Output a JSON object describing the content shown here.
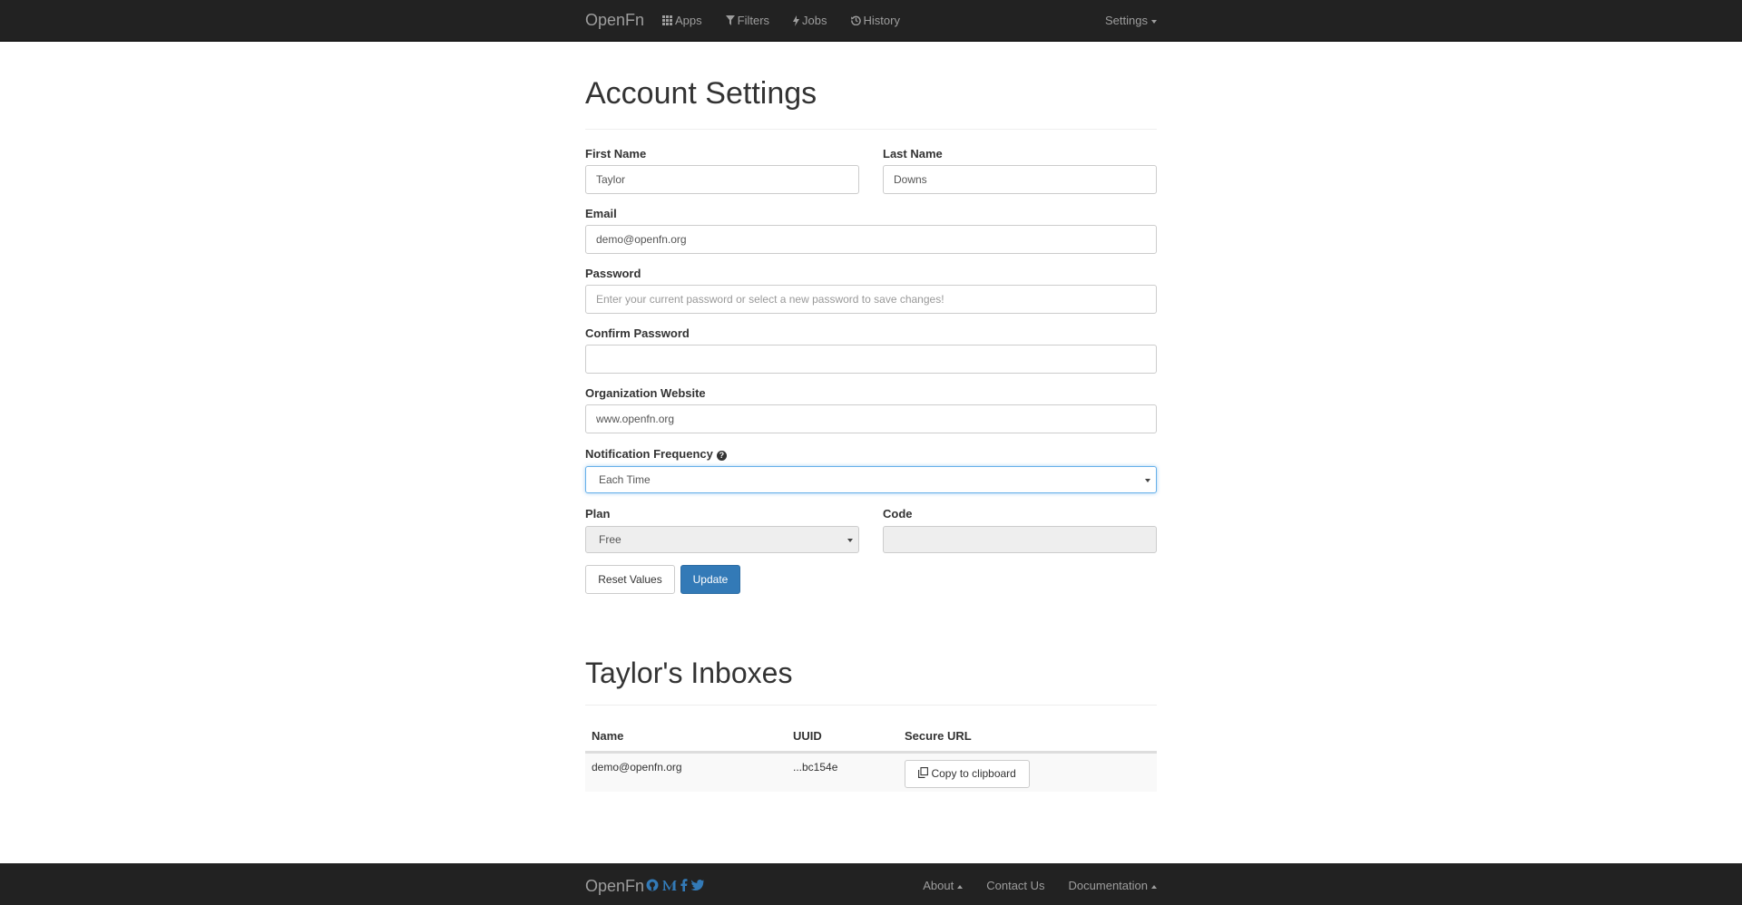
{
  "navbar": {
    "brand": "OpenFn",
    "links": [
      {
        "label": "Apps",
        "icon": "grid-icon"
      },
      {
        "label": "Filters",
        "icon": "filter-icon"
      },
      {
        "label": "Jobs",
        "icon": "bolt-icon"
      },
      {
        "label": "History",
        "icon": "history-icon"
      }
    ],
    "settings_label": "Settings"
  },
  "account": {
    "title": "Account Settings",
    "first_name": {
      "label": "First Name",
      "value": "Taylor"
    },
    "last_name": {
      "label": "Last Name",
      "value": "Downs"
    },
    "email": {
      "label": "Email",
      "value": "demo@openfn.org"
    },
    "password": {
      "label": "Password",
      "placeholder": "Enter your current password or select a new password to save changes!"
    },
    "confirm_password": {
      "label": "Confirm Password",
      "value": ""
    },
    "org_website": {
      "label": "Organization Website",
      "value": "www.openfn.org"
    },
    "notification_frequency": {
      "label": "Notification Frequency",
      "selected": "Each Time",
      "help_icon": "question-circle-icon"
    },
    "plan": {
      "label": "Plan",
      "selected": "Free"
    },
    "code": {
      "label": "Code",
      "value": ""
    },
    "reset_label": "Reset Values",
    "update_label": "Update"
  },
  "inboxes": {
    "title": "Taylor's Inboxes",
    "columns": [
      "Name",
      "UUID",
      "Secure URL"
    ],
    "rows": [
      {
        "name": "demo@openfn.org",
        "uuid": "...bc154e",
        "copy_label": "Copy to clipboard"
      }
    ]
  },
  "footer": {
    "brand": "OpenFn",
    "social_icons": [
      "github-icon",
      "medium-icon",
      "facebook-icon",
      "twitter-icon"
    ],
    "links": [
      {
        "label": "About",
        "caret": "up"
      },
      {
        "label": "Contact Us"
      },
      {
        "label": "Documentation",
        "caret": "up"
      }
    ]
  },
  "colors": {
    "navbar_bg": "#222222",
    "nav_text": "#9d9d9d",
    "primary": "#337ab7",
    "social_icon": "#337ab7"
  }
}
